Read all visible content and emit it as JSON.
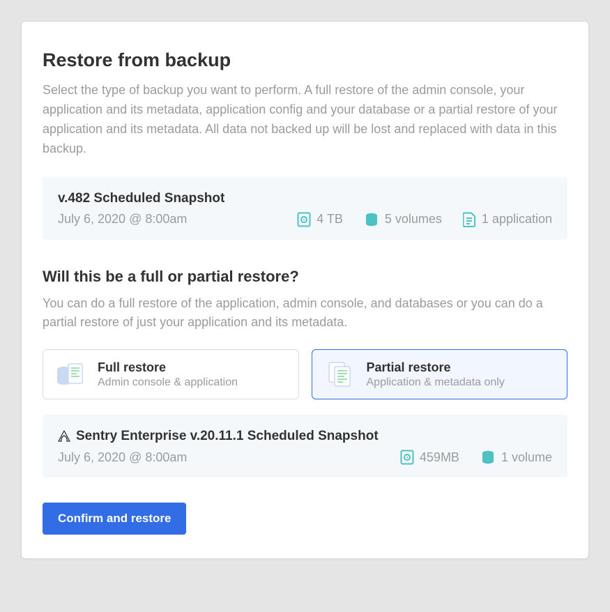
{
  "header": {
    "title": "Restore from backup",
    "description": "Select the type of backup you want to perform. A full restore of the admin console, your application and its metadata, application config and your database or a partial restore of your application and its metadata. All data not backed up will be lost and replaced with data in this backup."
  },
  "primary_snapshot": {
    "title": "v.482 Scheduled Snapshot",
    "date": "July 6, 2020 @ 8:00am",
    "size": "4 TB",
    "volumes": "5 volumes",
    "apps": "1 application"
  },
  "section": {
    "title": "Will this be a full or partial restore?",
    "description": "You can do a full restore of the application, admin console, and databases or you can do a partial restore of just your application and its metadata."
  },
  "options": {
    "full": {
      "title": "Full restore",
      "subtitle": "Admin console & application"
    },
    "partial": {
      "title": "Partial restore",
      "subtitle": "Application & metadata only"
    }
  },
  "secondary_snapshot": {
    "title": "Sentry Enterprise v.20.11.1 Scheduled Snapshot",
    "date": "July 6, 2020 @ 8:00am",
    "size": "459MB",
    "volumes": "1 volume"
  },
  "confirm_label": "Confirm and restore",
  "colors": {
    "accent": "#326de6",
    "teal": "#4ec2c2",
    "muted": "#9b9b9b"
  }
}
